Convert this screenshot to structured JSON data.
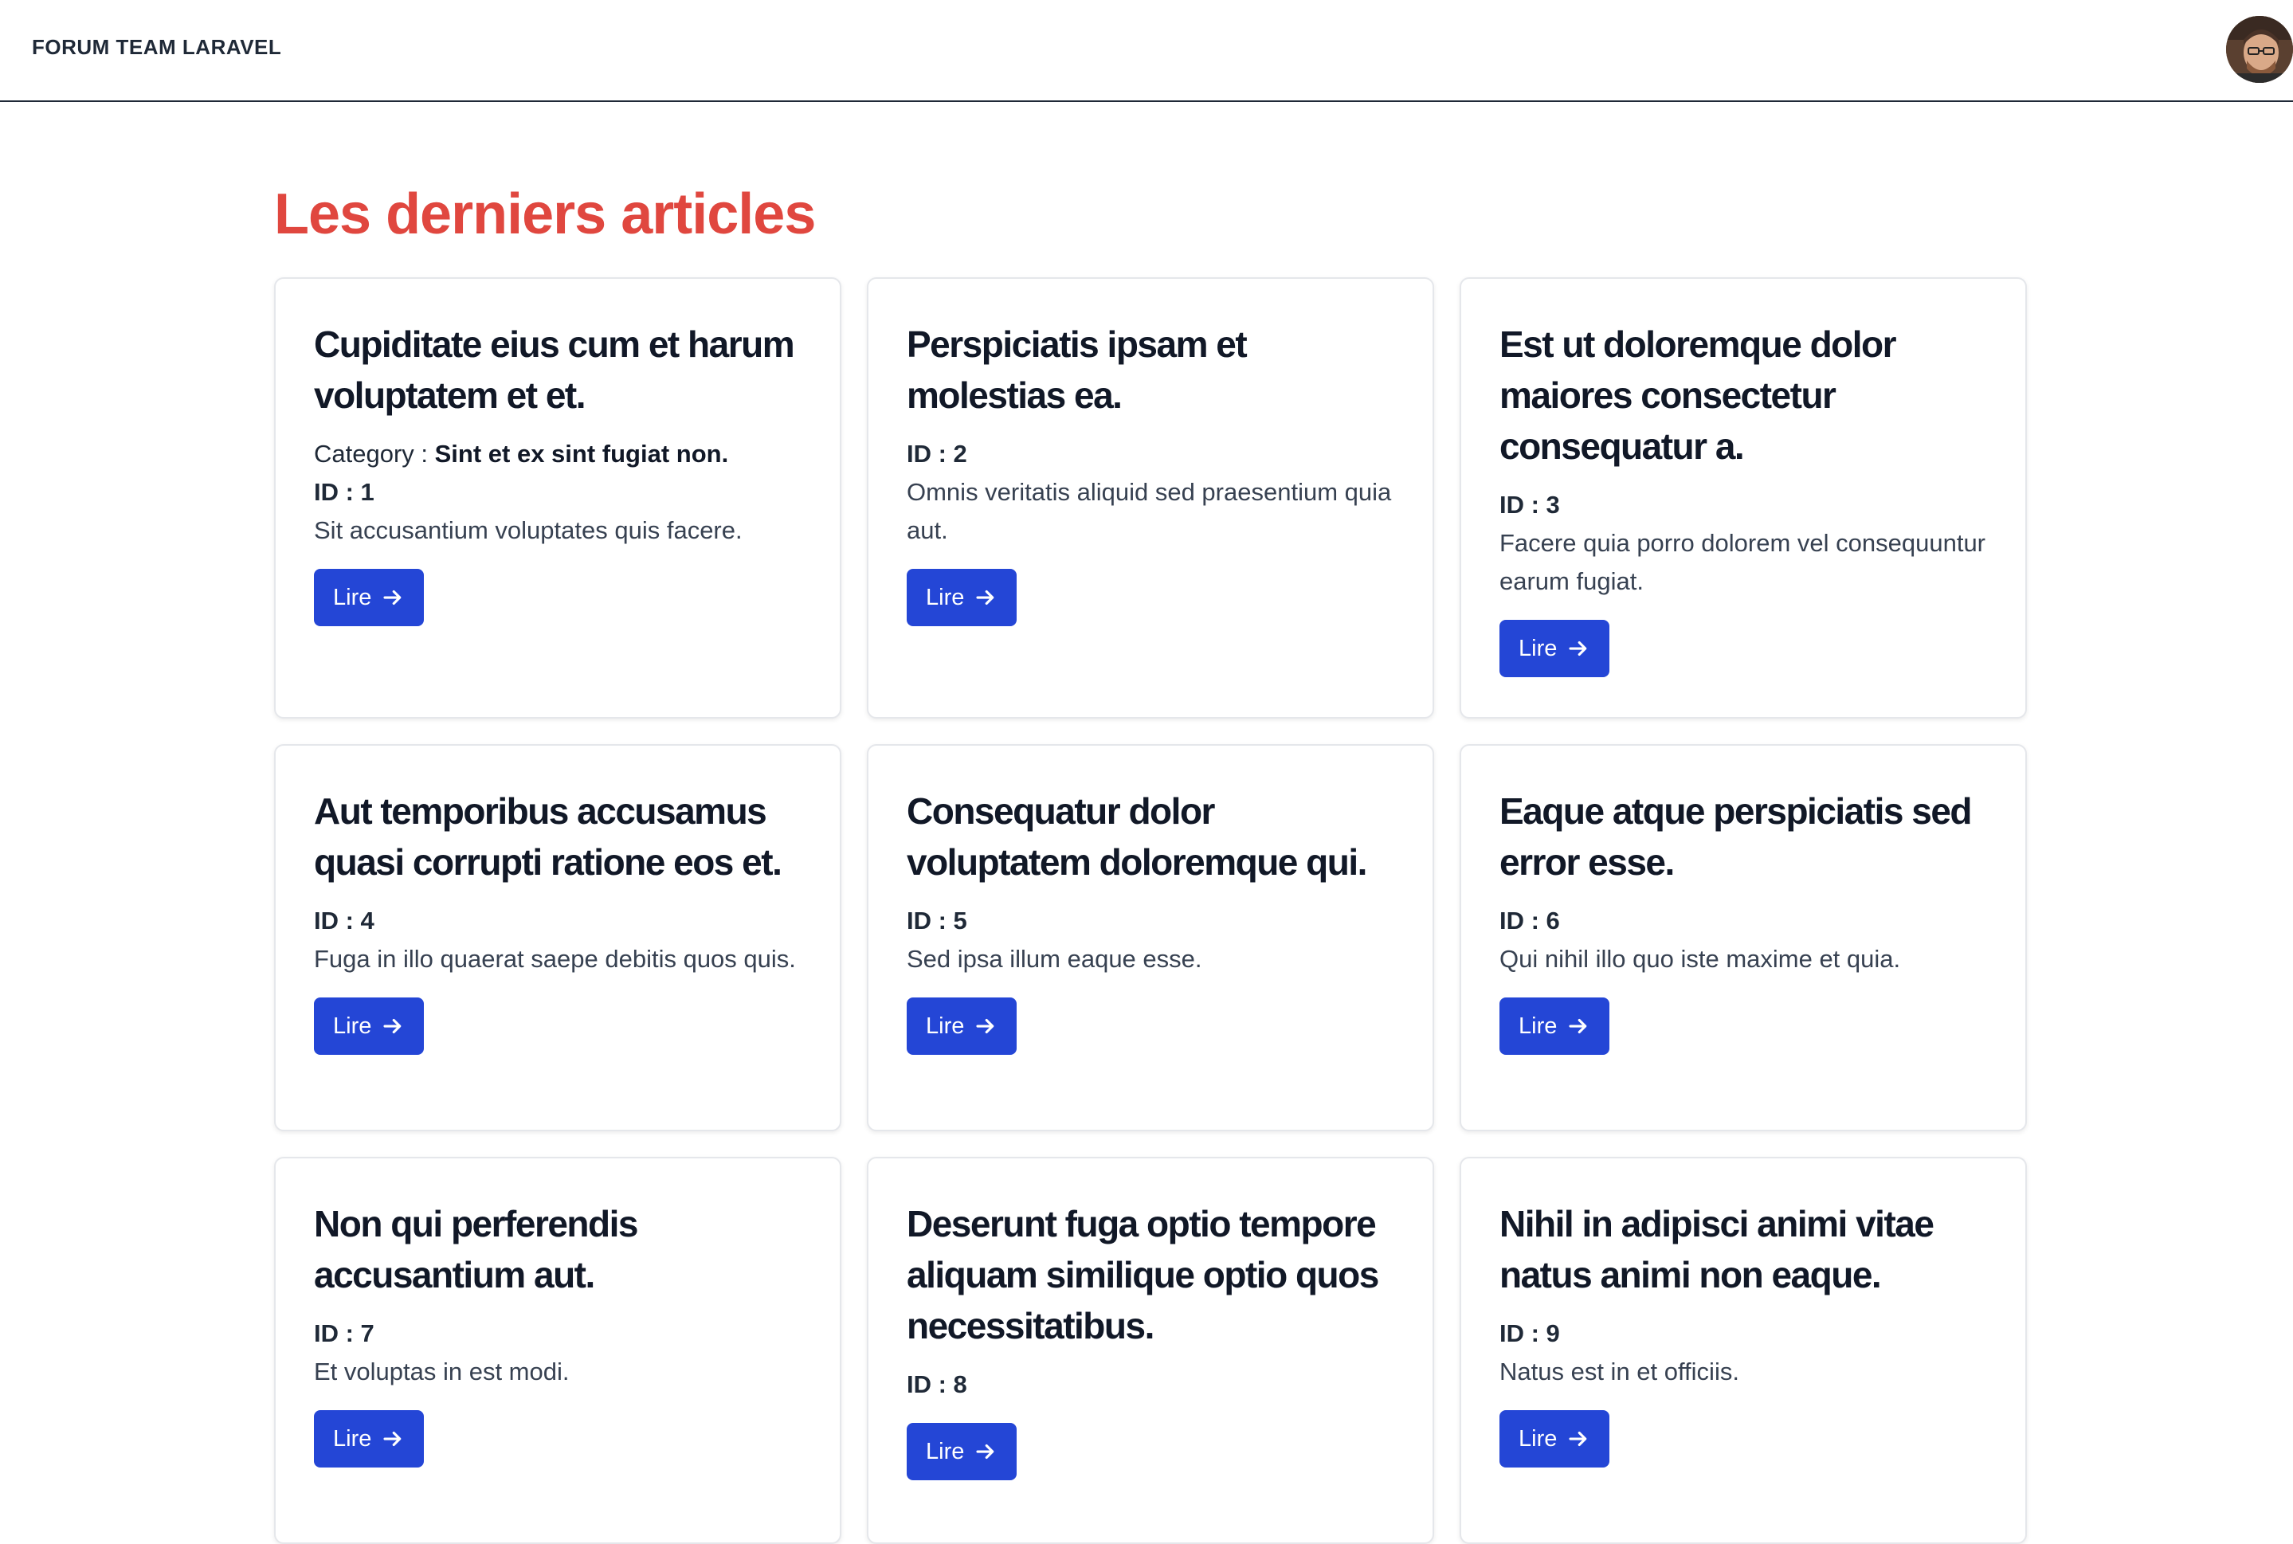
{
  "navbar": {
    "brand": "FORUM TEAM LARAVEL",
    "avatar_icon": "user-avatar-photo"
  },
  "page": {
    "title": "Les derniers articles"
  },
  "colors": {
    "title_accent": "#e0473f",
    "button_bg": "#2446d6"
  },
  "articles": [
    {
      "title": "Cupiditate eius cum et harum voluptatem et et.",
      "category_label": "Category : ",
      "category": "Sint et ex sint fugiat non.",
      "id": "ID : 1",
      "body": "Sit accusantium voluptates quis facere.",
      "button": "Lire"
    },
    {
      "title": "Perspiciatis ipsam et molestias ea.",
      "id": "ID : 2",
      "body": "Omnis veritatis aliquid sed praesentium quia aut.",
      "button": "Lire"
    },
    {
      "title": "Est ut doloremque dolor maiores consectetur consequatur a.",
      "id": "ID : 3",
      "body": "Facere quia porro dolorem vel consequuntur earum fugiat.",
      "button": "Lire"
    },
    {
      "title": "Aut temporibus accusamus quasi corrupti ratione eos et.",
      "id": "ID : 4",
      "body": "Fuga in illo quaerat saepe debitis quos quis.",
      "button": "Lire"
    },
    {
      "title": "Consequatur dolor voluptatem doloremque qui.",
      "id": "ID : 5",
      "body": "Sed ipsa illum eaque esse.",
      "button": "Lire"
    },
    {
      "title": "Eaque atque perspiciatis sed error esse.",
      "id": "ID : 6",
      "body": "Qui nihil illo quo iste maxime et quia.",
      "button": "Lire"
    },
    {
      "title": "Non qui perferendis accusantium aut.",
      "id": "ID : 7",
      "body": "Et voluptas in est modi.",
      "button": "Lire"
    },
    {
      "title": "Deserunt fuga optio tempore aliquam similique optio quos necessitatibus.",
      "id": "ID : 8",
      "body": "",
      "button": "Lire"
    },
    {
      "title": "Nihil in adipisci animi vitae natus animi non eaque.",
      "id": "ID : 9",
      "body": "Natus est in et officiis.",
      "button": "Lire"
    }
  ]
}
